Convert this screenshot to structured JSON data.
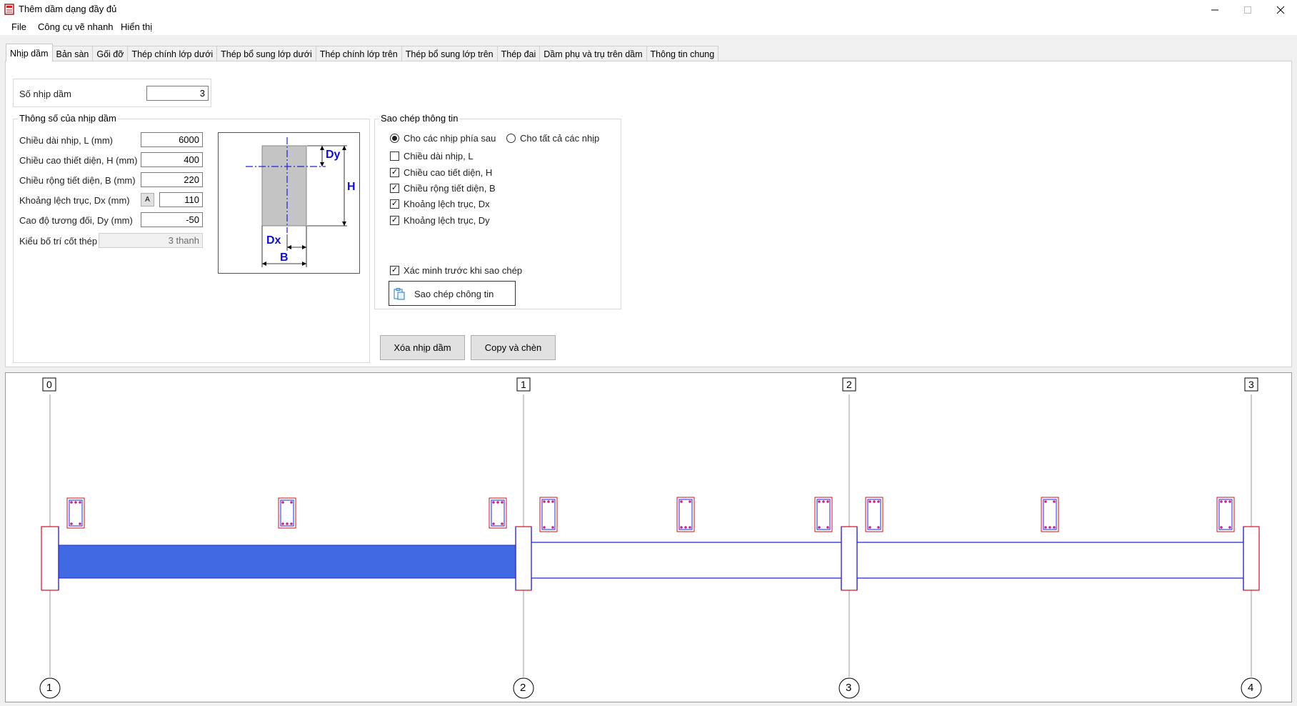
{
  "window": {
    "title": "Thêm dầm dạng đầy đủ"
  },
  "menu": [
    "File",
    "Công cụ vẽ nhanh",
    "Hiển thị"
  ],
  "tabs": [
    {
      "label": "Nhịp dầm",
      "active": true
    },
    {
      "label": "Bản sàn"
    },
    {
      "label": "Gối đỡ"
    },
    {
      "label": "Thép chính lớp dưới"
    },
    {
      "label": "Thép bổ sung lớp dưới"
    },
    {
      "label": "Thép chính lớp trên"
    },
    {
      "label": "Thép bổ sung lớp trên"
    },
    {
      "label": "Thép đai"
    },
    {
      "label": "Dầm phụ và trụ trên dầm"
    },
    {
      "label": "Thông tin chung"
    }
  ],
  "span_count": {
    "label": "Số nhịp dầm",
    "value": "3"
  },
  "span_params": {
    "legend": "Thông số của nhịp dầm",
    "length": {
      "label": "Chiều dài nhịp, L (mm)",
      "value": "6000"
    },
    "height": {
      "label": "Chiều cao thiết diện, H (mm)",
      "value": "400"
    },
    "width": {
      "label": "Chiều rộng tiết diện, B (mm)",
      "value": "220"
    },
    "dx": {
      "label": "Khoảng lệch trục, Dx (mm)",
      "button": "A",
      "value": "110"
    },
    "dy": {
      "label": "Cao độ tương đối, Dy (mm)",
      "value": "-50"
    },
    "layout": {
      "label": "Kiểu bố trí cốt thép",
      "value": "3 thanh"
    }
  },
  "section_diagram": {
    "dy": "Dy",
    "h": "H",
    "dx": "Dx",
    "b": "B"
  },
  "copy_info": {
    "legend": "Sao chép thông tin",
    "radio_after": {
      "label": "Cho các nhịp phía sau",
      "selected": true
    },
    "radio_all": {
      "label": "Cho tất cả các nhịp",
      "selected": false
    },
    "checks": [
      {
        "label": "Chiều dài nhịp, L",
        "checked": false
      },
      {
        "label": "Chiều cao tiết diện, H",
        "checked": true
      },
      {
        "label": "Chiều rộng tiết diện, B",
        "checked": true
      },
      {
        "label": "Khoảng lệch trục, Dx",
        "checked": true
      },
      {
        "label": "Khoảng lệch trục, Dy",
        "checked": true
      }
    ],
    "confirm": {
      "label": "Xác minh trước khi sao chép",
      "checked": true
    },
    "copy_button": "Sao chép chông tin"
  },
  "actions": {
    "delete_span": "Xóa nhịp dầm",
    "copy_insert": "Copy và chèn"
  },
  "drawing": {
    "axis_top": [
      "0",
      "1",
      "2",
      "3"
    ],
    "axis_bottom": [
      "1",
      "2",
      "3",
      "4"
    ],
    "colors": {
      "beam_fill": "#4169e1",
      "outline": "#1a2ad8",
      "support": "#cc1122",
      "rebar": "#cc2288"
    }
  }
}
